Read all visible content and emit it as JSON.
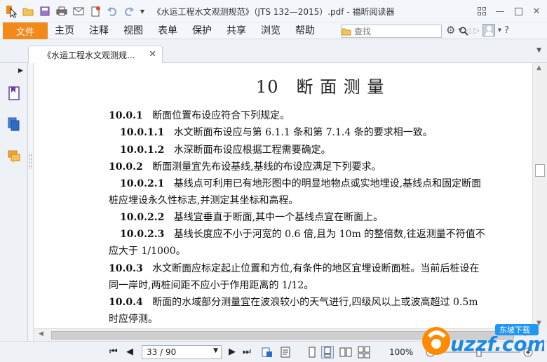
{
  "window": {
    "title": "《水运工程水文观测规范》（JTS 132—2015）.pdf - 福昕阅读器"
  },
  "menubar": {
    "file": "文件",
    "items": [
      "主页",
      "注释",
      "视图",
      "表单",
      "保护",
      "共享",
      "浏览",
      "帮助"
    ]
  },
  "search": {
    "placeholder": "查找"
  },
  "tab": {
    "label": "《水运工程水文观测规..."
  },
  "document": {
    "chapter": "10　断 面 测 量",
    "lines": [
      {
        "num": "10.0.1",
        "text": "断面位置布设应符合下列规定。"
      },
      {
        "num": "10.0.1.1",
        "text": "水文断面布设应与第 6.1.1 条和第 7.1.4 条的要求相一致。"
      },
      {
        "num": "10.0.1.2",
        "text": "水深断面布设应根据工程需要确定。"
      },
      {
        "num": "10.0.2",
        "text": "断面测量宜先布设基线,基线的布设应满足下列要求。"
      },
      {
        "num": "10.0.2.1",
        "text": "基线点可利用已有地形图中的明显地物点或实地埋设,基线点和固定断面"
      },
      {
        "num": "",
        "text": "桩应埋设永久性标志,并测定其坐标和高程。"
      },
      {
        "num": "10.0.2.2",
        "text": "基线宜垂直于断面,其中一个基线点宜在断面上。"
      },
      {
        "num": "10.0.2.3",
        "text": "基线长度应不小于河宽的 0.6 倍,且为 10m 的整倍数,往返测量不符值不"
      },
      {
        "num": "",
        "text": "应大于 1/1000。"
      },
      {
        "num": "10.0.3",
        "text": "水文断面应标定起止位置和方位,有条件的地区宜埋设断面桩。当前后桩设在"
      },
      {
        "num": "",
        "text": "同一岸时,两桩间距不应小于作用距离的 1/12。"
      },
      {
        "num": "10.0.4",
        "text": "断面的水域部分测量宜在波浪较小的天气进行,四级风以上或波高超过 0.5m"
      },
      {
        "num": "",
        "text": "时应停测。"
      }
    ]
  },
  "status": {
    "page": "33 / 90",
    "zoom": "100%"
  },
  "watermark": {
    "text": "uzzf.com",
    "badge": "东坡下载"
  },
  "colors": {
    "accent": "#f28a1a",
    "icon_purple": "#6b3fa0",
    "icon_blue": "#2b6cc4"
  },
  "icons": [
    "select-icon",
    "open-icon",
    "save-icon",
    "print-icon",
    "email-icon",
    "new-icon",
    "undo-icon",
    "redo-icon",
    "search-icon",
    "settings-icon",
    "prev-icon",
    "next-icon",
    "avatar-icon"
  ]
}
